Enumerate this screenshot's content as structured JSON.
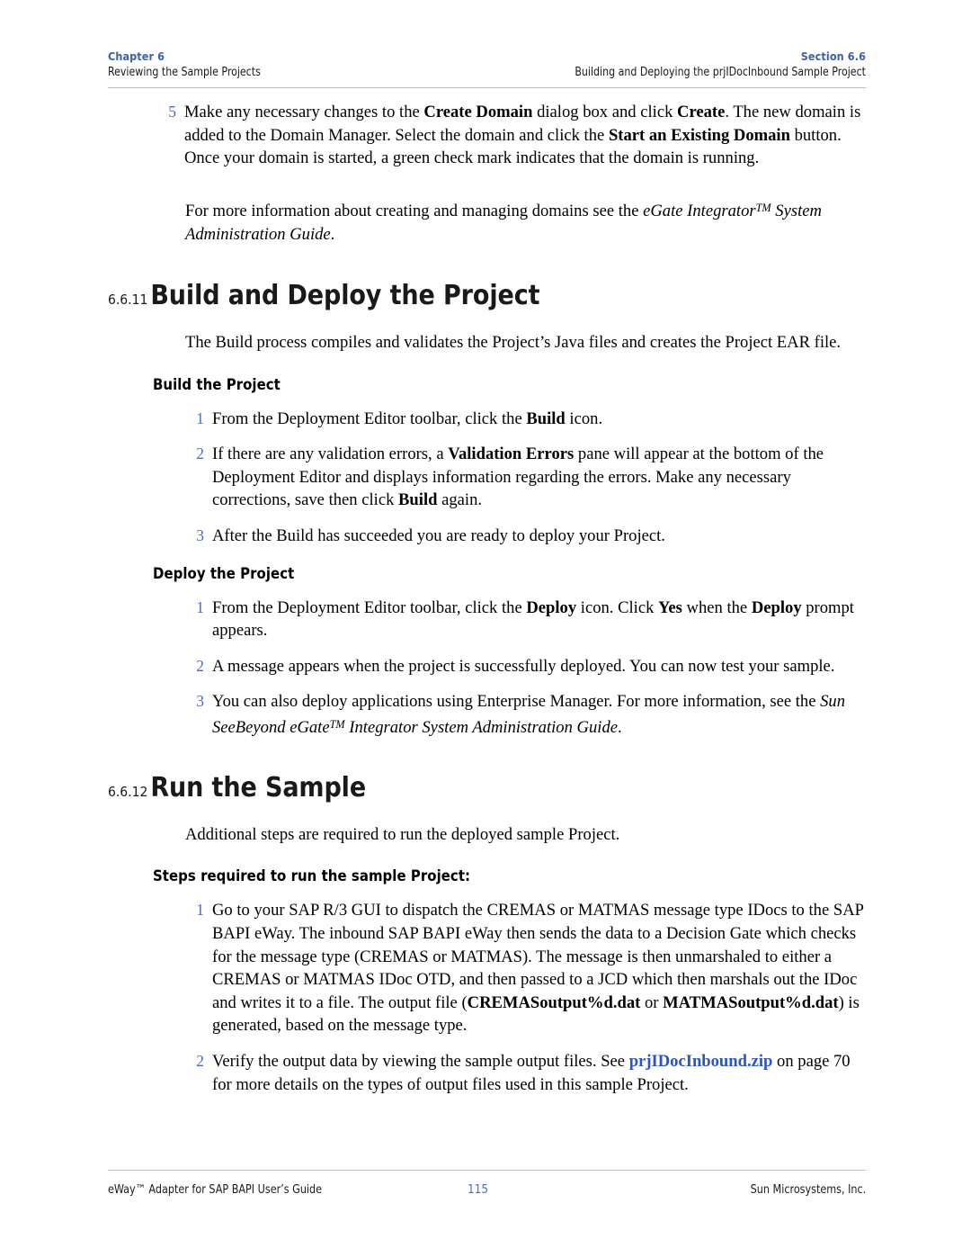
{
  "header": {
    "left_top": "Chapter 6",
    "left_bottom": "Reviewing the Sample Projects",
    "right_top": "Section 6.6",
    "right_bottom": "Building and Deploying the prjIDocInbound Sample Project"
  },
  "footer": {
    "left": "eWay™ Adapter for SAP BAPI User’s Guide",
    "page_number": "115",
    "right": "Sun Microsystems, Inc."
  },
  "content": {
    "step5": {
      "number": "5",
      "text_html": "Make any necessary changes to the <b>Create Domain</b> dialog box and click <b>Create</b>. The new domain is added to the Domain Manager. Select the domain and click the <b>Start an Existing Domain</b> button. Once your domain is started, a green check mark indicates that the domain is running."
    },
    "cross_ref_para_html": "For more information about creating and managing domains see the <i>eGate Integrator<span class=\"tm\">TM</span> System Administration Guide</i>.",
    "section_6_6_11": {
      "number": "6.6.11",
      "title": "Build and Deploy the Project",
      "intro": "The Build process compiles and validates the Project’s Java files and creates the Project EAR file.",
      "build_subhead": "Build the Project",
      "build_steps": [
        {
          "number": "1",
          "text_html": "From the Deployment Editor toolbar, click the <b>Build</b> icon."
        },
        {
          "number": "2",
          "text_html": "If there are any validation errors, a <b>Validation Errors</b> pane will appear at the bottom of the Deployment Editor and displays information regarding the errors. Make any necessary corrections, save then click <b>Build</b> again."
        },
        {
          "number": "3",
          "text_html": "After the Build has succeeded you are ready to deploy your Project."
        }
      ],
      "deploy_subhead": "Deploy the Project",
      "deploy_steps": [
        {
          "number": "1",
          "text_html": "From the Deployment Editor toolbar, click the <b>Deploy</b> icon. Click <b>Yes</b> when the <b>Deploy</b> prompt appears."
        },
        {
          "number": "2",
          "text_html": "A message appears when the project is successfully deployed. You can now test your sample."
        },
        {
          "number": "3",
          "text_html": "You can also deploy applications using Enterprise Manager. For more information, see the <i>Sun SeeBeyond eGate<span class=\"tm\">TM</span> Integrator System Administration Guide</i>."
        }
      ]
    },
    "section_6_6_12": {
      "number": "6.6.12",
      "title": "Run the Sample",
      "intro": "Additional steps are required to run the deployed sample Project.",
      "steps_subhead": "Steps required to run the sample Project:",
      "steps": [
        {
          "number": "1",
          "text_html": "Go to your SAP R/3 GUI to dispatch the CREMAS or MATMAS message type IDocs to the SAP BAPI eWay. The inbound SAP BAPI eWay then sends the data to a Decision Gate which checks for the message type (CREMAS or MATMAS). The message is then unmarshaled to either a CREMAS or MATMAS IDoc OTD, and then passed to a JCD which then marshals out the IDoc and writes it to a file. The output file (<b>CREMASoutput%d.dat</b> or <b>MATMASoutput%d.dat</b>) is generated, based on the message type."
        },
        {
          "number": "2",
          "text_html": "Verify the output data by viewing the sample output files. See <span class=\"link\">prjIDocInbound.zip</span> on page 70 for more details on the types of output files used in this sample Project."
        }
      ]
    }
  },
  "colors": {
    "header_accent": "#3c5fae",
    "list_number": "#4a6cc0",
    "link": "#2a54c8",
    "rule": "#b9b9b9",
    "text": "#000000"
  }
}
